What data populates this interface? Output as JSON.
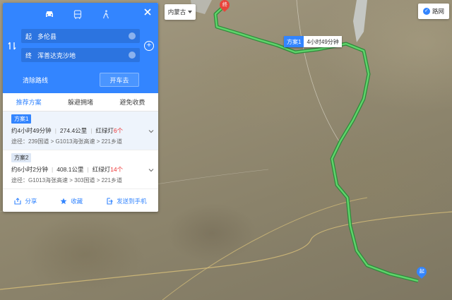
{
  "panel": {
    "travel_modes": [
      {
        "icon": "car-icon",
        "active": true
      },
      {
        "icon": "bus-icon",
        "active": false
      },
      {
        "icon": "walk-icon",
        "active": false
      }
    ],
    "start": {
      "tag": "起",
      "value": "多伦县"
    },
    "end": {
      "tag": "终",
      "value": "浑善达克沙地"
    },
    "clear_label": "清除路线",
    "go_label": "开车去",
    "tabs": [
      {
        "label": "推荐方案",
        "active": true
      },
      {
        "label": "躲避拥堵",
        "active": false
      },
      {
        "label": "避免收费",
        "active": false
      }
    ],
    "routes": [
      {
        "name": "方案1",
        "duration": "约4小时49分钟",
        "distance": "274.4公里",
        "lights_label": "红绿灯",
        "lights_count": "6个",
        "via": "途径：239国道 > G1013海张高速 > 221乡道"
      },
      {
        "name": "方案2",
        "duration": "约6小时2分钟",
        "distance": "408.1公里",
        "lights_label": "红绿灯",
        "lights_count": "14个",
        "via": "途径：G1013海张高速 > 303国道 > 221乡道"
      }
    ],
    "actions": [
      {
        "label": "分享",
        "icon": "share-icon"
      },
      {
        "label": "收藏",
        "icon": "star-icon"
      },
      {
        "label": "发送到手机",
        "icon": "send-to-phone-icon"
      }
    ]
  },
  "map": {
    "city_selector": "内蒙古",
    "road_toggle": "路网",
    "route_label": {
      "name": "方案1",
      "time": "4小时49分钟"
    },
    "start_pin": "起",
    "end_pin": "终",
    "colors": {
      "accent": "#3385ff",
      "route": "#3ab54a",
      "red": "#e33"
    }
  }
}
